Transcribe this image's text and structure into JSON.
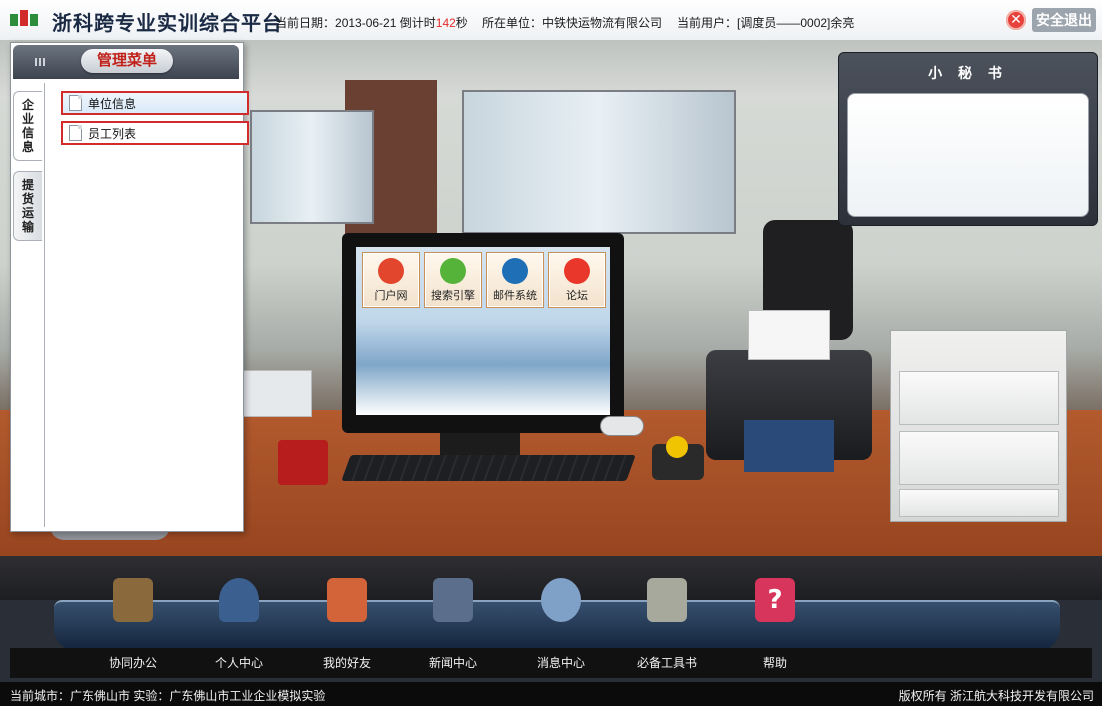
{
  "header": {
    "app_title": "浙科跨专业实训综合平台",
    "date_label": "当前日期：",
    "date_value": "2013-06-21",
    "countdown_label": "倒计时",
    "countdown_value": "142",
    "countdown_unit": "秒",
    "unit_label": "所在单位：",
    "unit_value": "中铁快运物流有限公司",
    "user_label": "当前用户：",
    "user_value": "[调度员——0002]余亮",
    "logout_label": "安全退出"
  },
  "menu": {
    "title": "管理菜单",
    "tabs": [
      {
        "label": "企业信息"
      },
      {
        "label": "提货运输"
      }
    ],
    "items": [
      {
        "label": "单位信息"
      },
      {
        "label": "员工列表"
      }
    ]
  },
  "desktop_apps": [
    {
      "label": "门户网",
      "color": "#e2462c",
      "icon": "portal-icon"
    },
    {
      "label": "搜索引擎",
      "color": "#56b33a",
      "icon": "search-engine-icon"
    },
    {
      "label": "邮件系统",
      "color": "#1f6fb6",
      "icon": "mail-icon"
    },
    {
      "label": "论坛",
      "color": "#e9382b",
      "icon": "forum-icon"
    }
  ],
  "secretary": {
    "title": "小 秘 书"
  },
  "dock": [
    {
      "label": "协同办公",
      "icon": "books-icon",
      "color": "#8a6a3d"
    },
    {
      "label": "个人中心",
      "icon": "person-icon",
      "color": "#3b5f8f"
    },
    {
      "label": "我的好友",
      "icon": "photo-icon",
      "color": "#d3643a"
    },
    {
      "label": "新闻中心",
      "icon": "news-icon",
      "color": "#5b6f8c"
    },
    {
      "label": "消息中心",
      "icon": "chat-icon",
      "color": "#7fa1c8"
    },
    {
      "label": "必备工具书",
      "icon": "folder-icon",
      "color": "#a7a99d"
    },
    {
      "label": "帮助",
      "icon": "help-icon",
      "color": "#d8355c"
    }
  ],
  "status": {
    "left": "当前城市：广东佛山市  实验：广东佛山市工业企业模拟实验",
    "right": "版权所有 浙江航大科技开发有限公司"
  }
}
